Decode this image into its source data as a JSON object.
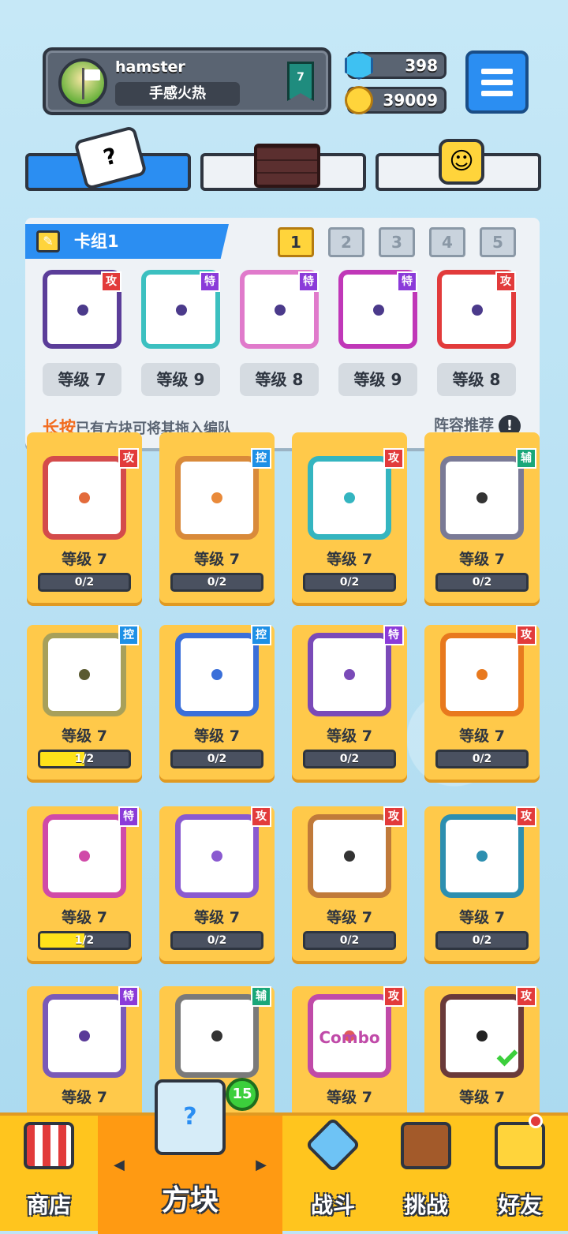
{
  "profile": {
    "username": "hamster",
    "title": "手感火热",
    "rank": "7"
  },
  "currency": {
    "gems": "398",
    "coins": "39009"
  },
  "tabs": [
    {
      "name": "dice",
      "glyph": "?"
    },
    {
      "name": "board",
      "glyph": ""
    },
    {
      "name": "emote",
      "glyph": "☺"
    }
  ],
  "deck": {
    "label": "卡组1",
    "pages": [
      "1",
      "2",
      "3",
      "4",
      "5"
    ],
    "active_page": 1,
    "cards": [
      {
        "tag": "攻",
        "tag_type": "atk",
        "level": "等级 7",
        "border": "#5b3d99"
      },
      {
        "tag": "特",
        "tag_type": "spc",
        "level": "等级 9",
        "border": "#3cc0c0"
      },
      {
        "tag": "特",
        "tag_type": "spc",
        "level": "等级 8",
        "border": "#e07acb"
      },
      {
        "tag": "特",
        "tag_type": "spc",
        "level": "等级 9",
        "border": "#c037b8"
      },
      {
        "tag": "攻",
        "tag_type": "atk",
        "level": "等级 8",
        "border": "#e23b3b"
      }
    ],
    "hint_highlight": "长按",
    "hint_text": "已有方块可将其拖入编队",
    "recommend": "阵容推荐",
    "recommend_icon": "!"
  },
  "collection": [
    {
      "tag": "攻",
      "tag_type": "atk",
      "level": "等级 7",
      "progress_text": "0/2",
      "progress": 0,
      "border": "#d44b4b",
      "dot": "#e36b3b"
    },
    {
      "tag": "控",
      "tag_type": "ctl",
      "level": "等级 7",
      "progress_text": "0/2",
      "progress": 0,
      "border": "#d98a3a",
      "dot": "#e98a3a"
    },
    {
      "tag": "攻",
      "tag_type": "atk",
      "level": "等级 7",
      "progress_text": "0/2",
      "progress": 0,
      "border": "#34b5c0",
      "dot": "#34b5c0"
    },
    {
      "tag": "辅",
      "tag_type": "sup",
      "level": "等级 7",
      "progress_text": "0/2",
      "progress": 0,
      "border": "#7a7a96",
      "dot": "#333"
    },
    {
      "tag": "控",
      "tag_type": "ctl",
      "level": "等级 7",
      "progress_text": "1/2",
      "progress": 0.5,
      "border": "#a8a05a",
      "dot": "#5a5a30"
    },
    {
      "tag": "控",
      "tag_type": "ctl",
      "level": "等级 7",
      "progress_text": "0/2",
      "progress": 0,
      "border": "#3a6fd9",
      "dot": "#3a6fd9"
    },
    {
      "tag": "特",
      "tag_type": "spc",
      "level": "等级 7",
      "progress_text": "0/2",
      "progress": 0,
      "border": "#7a4ab8",
      "dot": "#7a4ab8"
    },
    {
      "tag": "攻",
      "tag_type": "atk",
      "level": "等级 7",
      "progress_text": "0/2",
      "progress": 0,
      "border": "#e8791e",
      "dot": "#e8791e"
    },
    {
      "tag": "特",
      "tag_type": "spc",
      "level": "等级 7",
      "progress_text": "1/2",
      "progress": 0.5,
      "border": "#d04aa8",
      "dot": "#d04aa8"
    },
    {
      "tag": "攻",
      "tag_type": "atk",
      "level": "等级 7",
      "progress_text": "0/2",
      "progress": 0,
      "border": "#8a5ad0",
      "dot": "#8a5ad0"
    },
    {
      "tag": "攻",
      "tag_type": "atk",
      "level": "等级 7",
      "progress_text": "0/2",
      "progress": 0,
      "border": "#c07a3a",
      "dot": "#333"
    },
    {
      "tag": "攻",
      "tag_type": "atk",
      "level": "等级 7",
      "progress_text": "0/2",
      "progress": 0,
      "border": "#2d8fb0",
      "dot": "#2d8fb0"
    },
    {
      "tag": "特",
      "tag_type": "spc",
      "level": "等级 7",
      "border": "#7a5ab8",
      "dot": "#5a3a98"
    },
    {
      "tag": "辅",
      "tag_type": "sup",
      "level": "等级 7",
      "border": "#7a7a7a",
      "dot": "#333"
    },
    {
      "tag": "攻",
      "tag_type": "atk",
      "level": "等级 7",
      "border": "#c04aa8",
      "dot": "#e05a5a",
      "label": "Combo"
    },
    {
      "tag": "攻",
      "tag_type": "atk",
      "level": "等级 7",
      "border": "#6a3a3a",
      "dot": "#222",
      "checked": true
    }
  ],
  "nav": {
    "shop": "商店",
    "blocks": "方块",
    "blocks_badge": "15",
    "box_glyph": "?",
    "battle": "战斗",
    "challenge": "挑战",
    "friends": "好友",
    "arrow_left": "◀",
    "arrow_right": "▶"
  }
}
